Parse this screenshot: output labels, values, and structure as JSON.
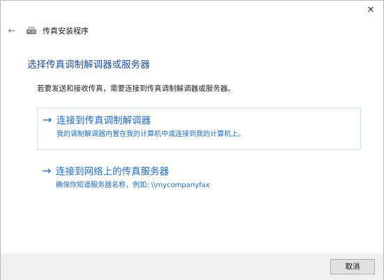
{
  "window": {
    "title": "传真安装程序",
    "close_glyph": "✕",
    "back_glyph": "←"
  },
  "page": {
    "heading": "选择传真调制解调器或服务器",
    "instruction": "若要发送和接收传真，需要连接到传真调制解调器或服务器。"
  },
  "options": [
    {
      "arrow": "→",
      "title": "连接到传真调制解调器",
      "description": "我的调制解调器内置在我的计算机中或连接到我的计算机上。"
    },
    {
      "arrow": "→",
      "title": "连接到网络上的传真服务器",
      "description": "确保你知道服务器名称，例如: \\\\mycompanyfax"
    }
  ],
  "footer": {
    "cancel_label": "取消"
  },
  "colors": {
    "heading": "#1f4d9c",
    "link": "#1c6ac7",
    "footer_bg": "#f0f0f0"
  }
}
